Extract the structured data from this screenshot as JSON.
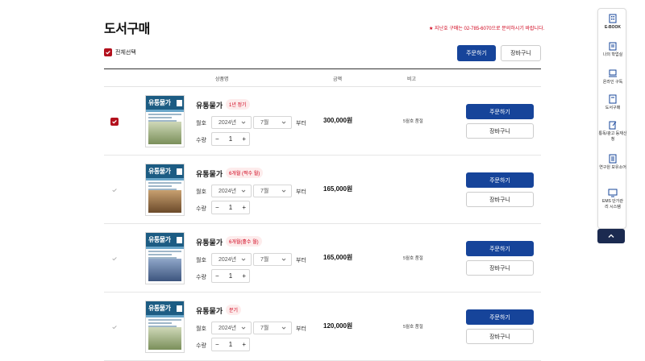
{
  "page": {
    "title": "도서구매",
    "notice": "★ 지난호 구매는 02-785-6070으로 문의하시기 바랍니다."
  },
  "toolbar": {
    "select_all_label": "전체선택",
    "order_label": "주문하기",
    "cart_label": "장바구니"
  },
  "table": {
    "headers": {
      "product": "상품명",
      "price": "금액",
      "note": "비고"
    }
  },
  "labels": {
    "issue": "월호",
    "from": "부터",
    "qty": "수량",
    "minus": "−",
    "plus": "+",
    "order": "주문하기",
    "cart": "장바구니"
  },
  "cover": {
    "title": "유통물가"
  },
  "products": [
    {
      "checked": true,
      "name": "유통물가",
      "tag": "1년 정기",
      "year": "2024년",
      "month": "7월",
      "qty": "1",
      "price": "300,000원",
      "note": "5월호 품절"
    },
    {
      "checked": false,
      "name": "유통물가",
      "tag": "6개월 (짝수 월)",
      "year": "2024년",
      "month": "7월",
      "qty": "1",
      "price": "165,000원",
      "note": ""
    },
    {
      "checked": false,
      "name": "유통물가",
      "tag": "6개월(홀수 월)",
      "year": "2024년",
      "month": "7월",
      "qty": "1",
      "price": "165,000원",
      "note": "5월호 품절"
    },
    {
      "checked": false,
      "name": "유통물가",
      "tag": "분기",
      "year": "2024년",
      "month": "7월",
      "qty": "1",
      "price": "120,000원",
      "note": "5월호 품절"
    }
  ],
  "sidebar": {
    "items": [
      {
        "label": "E-BOOK",
        "icon": "building-icon"
      },
      {
        "label": "나의 학업실",
        "icon": "folder-icon"
      },
      {
        "label": "온라인 구독",
        "icon": "laptop-icon"
      },
      {
        "label": "도서구매",
        "icon": "book-icon"
      },
      {
        "label": "통독/광고 등재신청",
        "icon": "pen-icon"
      },
      {
        "label": "연구원 보유소어",
        "icon": "document-icon"
      },
      {
        "label": "EMS 단가관리 시스템",
        "icon": "monitor-icon"
      }
    ]
  },
  "colors": {
    "primary": "#16449a",
    "accent": "#b3111d",
    "notice": "#d0021b",
    "sidebar_up": "#1b2a50"
  }
}
